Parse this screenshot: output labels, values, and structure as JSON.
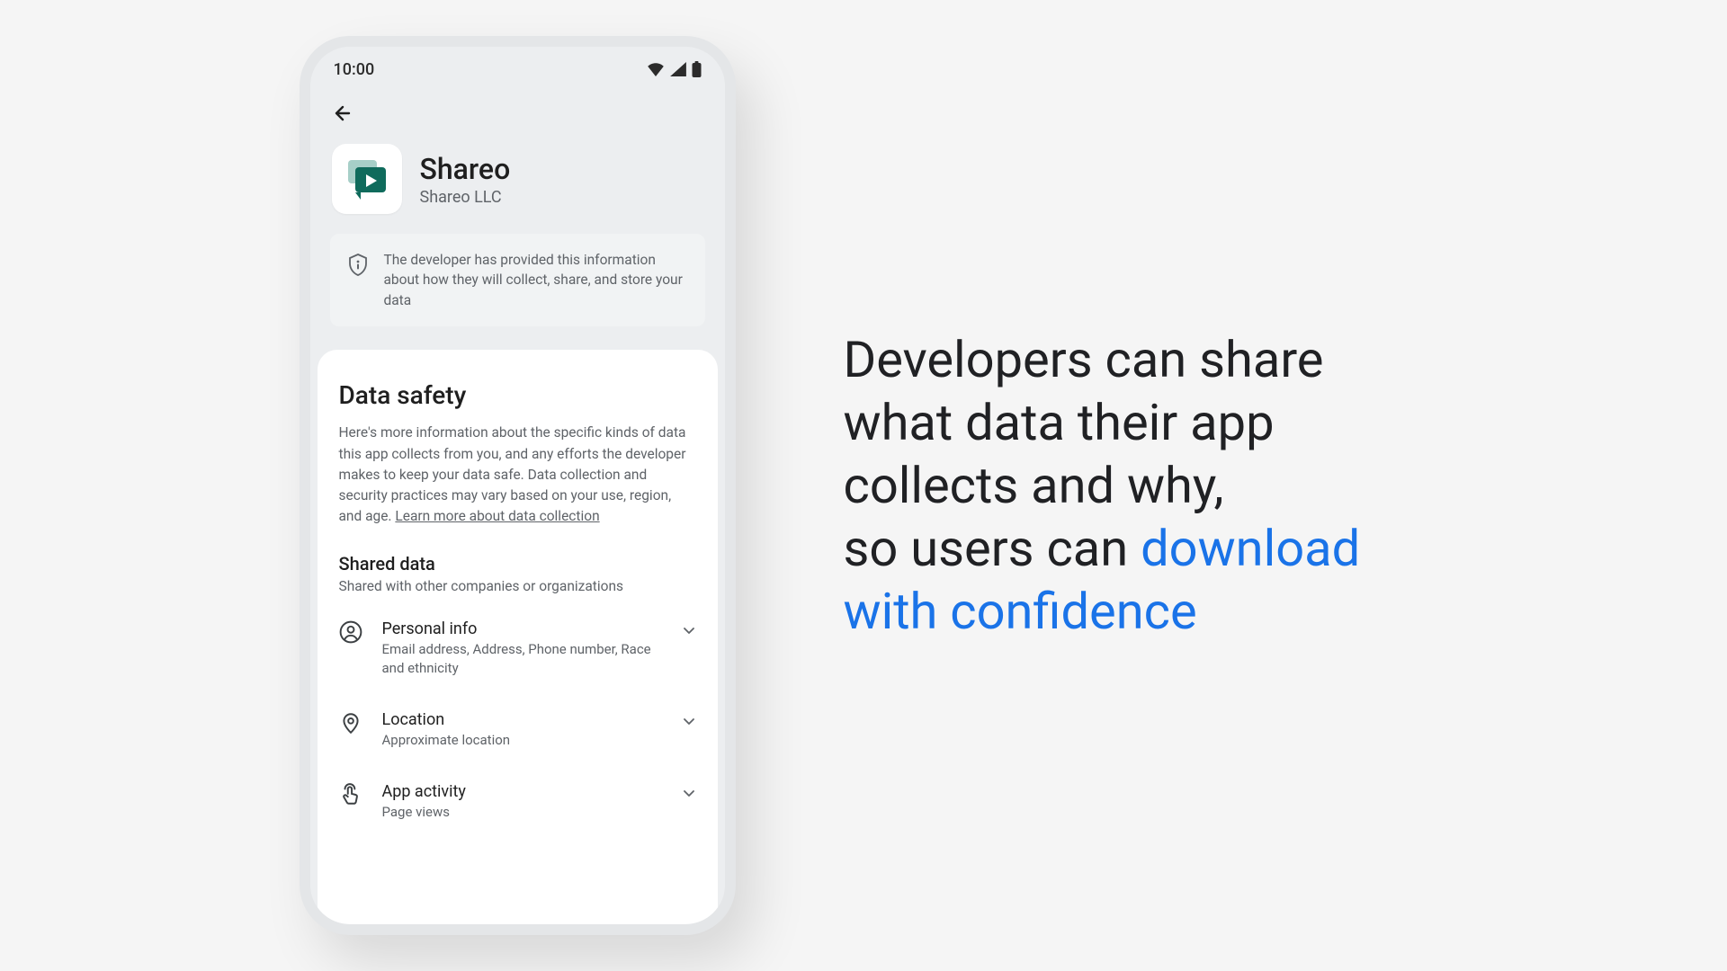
{
  "statusbar": {
    "time": "10:00"
  },
  "app": {
    "name": "Shareo",
    "developer": "Shareo LLC"
  },
  "banner": {
    "text": "The developer has provided this information about how they will collect, share, and store your data"
  },
  "card": {
    "title": "Data safety",
    "description": "Here's more information about the specific kinds of data this app collects from you, and any efforts the developer makes to keep your data safe. Data collection and security practices may vary based on your use, region, and age. ",
    "learn_more": "Learn more about data collection",
    "shared": {
      "heading": "Shared data",
      "subheading": "Shared with other companies or organizations"
    },
    "items": [
      {
        "icon": "person",
        "title": "Personal info",
        "sub": "Email address, Address, Phone number, Race and ethnicity"
      },
      {
        "icon": "location",
        "title": "Location",
        "sub": "Approximate location"
      },
      {
        "icon": "touch",
        "title": "App activity",
        "sub": "Page views"
      }
    ]
  },
  "marketing": {
    "line1": "Developers can share what data their app collects and why,",
    "line2_prefix": "so users can ",
    "line2_highlight": "download with confidence"
  }
}
